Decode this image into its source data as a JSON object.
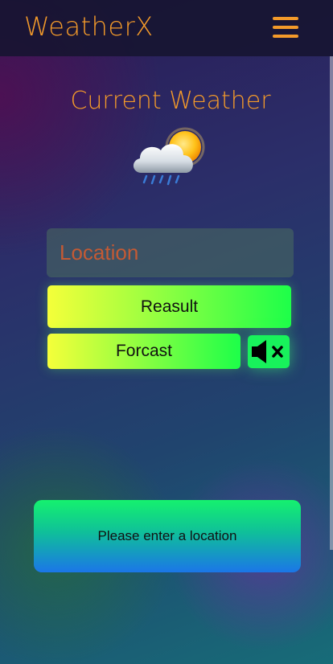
{
  "header": {
    "brand": "WeatherX",
    "menu_icon": "hamburger-icon",
    "accent_color": "#f39a2a"
  },
  "main": {
    "title": "Current Weather",
    "weather_icon": "sun-behind-rain-cloud-icon"
  },
  "search": {
    "placeholder": "Location",
    "value": ""
  },
  "buttons": {
    "result_label": "Reasult",
    "forecast_label": "Forcast",
    "mute_icon": "speaker-muted-icon"
  },
  "status": {
    "message": "Please enter a location"
  }
}
